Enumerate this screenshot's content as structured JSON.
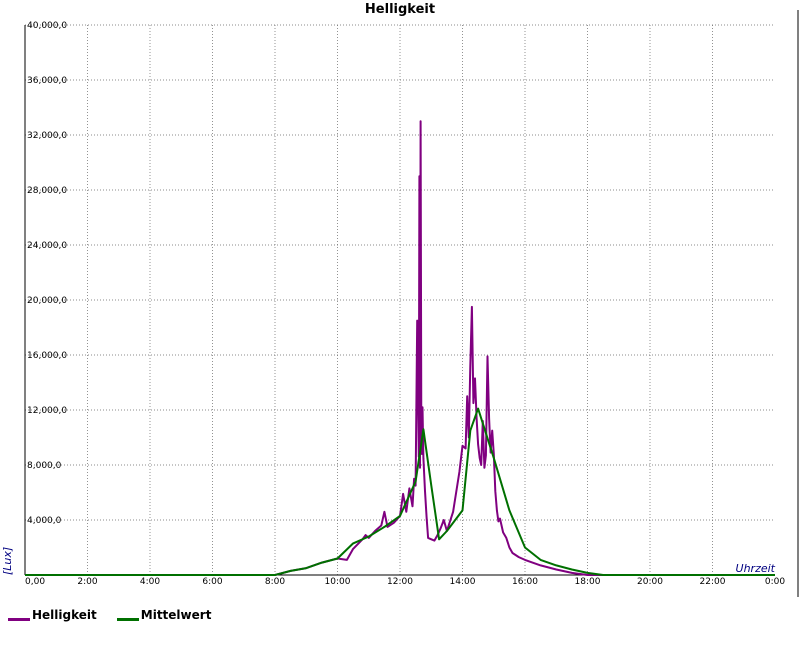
{
  "chart_data": {
    "type": "line",
    "title": "Helligkeit",
    "ylabel": "[Lux]",
    "xlabel": "Uhrzeit",
    "xlim": [
      0,
      24
    ],
    "ylim": [
      0,
      40000
    ],
    "grid": true,
    "legend_position": "bottom-left",
    "x_ticks": [
      "0,00",
      "2:00",
      "4:00",
      "6:00",
      "8:00",
      "10:00",
      "12:00",
      "14:00",
      "16:00",
      "18:00",
      "20:00",
      "22:00",
      "0:00"
    ],
    "y_ticks": [
      "4,000,0",
      "8,000,0",
      "12,000,0",
      "16,000,0",
      "20,000,0",
      "24,000,0",
      "28,000,0",
      "32,000,0",
      "36,000,0",
      "40,000,0"
    ],
    "series": [
      {
        "name": "Helligkeit",
        "color": "#800080",
        "x": [
          0,
          8.0,
          8.5,
          9.0,
          9.5,
          10.0,
          10.3,
          10.5,
          10.8,
          10.9,
          11.0,
          11.2,
          11.4,
          11.5,
          11.6,
          11.8,
          12.0,
          12.1,
          12.2,
          12.3,
          12.4,
          12.45,
          12.5,
          12.55,
          12.6,
          12.62,
          12.64,
          12.66,
          12.68,
          12.7,
          12.72,
          12.75,
          12.8,
          12.85,
          12.9,
          13.0,
          13.1,
          13.2,
          13.3,
          13.4,
          13.5,
          13.7,
          13.9,
          14.0,
          14.1,
          14.15,
          14.2,
          14.25,
          14.3,
          14.35,
          14.4,
          14.45,
          14.5,
          14.55,
          14.6,
          14.65,
          14.7,
          14.75,
          14.8,
          14.85,
          14.9,
          14.95,
          15.0,
          15.05,
          15.1,
          15.15,
          15.2,
          15.3,
          15.4,
          15.5,
          15.6,
          15.8,
          16.0,
          16.5,
          17.0,
          17.5,
          18.0,
          18.5,
          19.0,
          24.0
        ],
        "values": [
          0,
          0,
          300,
          500,
          900,
          1200,
          1100,
          1900,
          2600,
          2900,
          2700,
          3200,
          3600,
          4600,
          3500,
          3800,
          4300,
          5900,
          4600,
          6300,
          5000,
          7000,
          6500,
          18500,
          8600,
          29000,
          7800,
          33000,
          11000,
          8800,
          12200,
          8500,
          6100,
          4200,
          2700,
          2600,
          2500,
          2900,
          3400,
          4000,
          3200,
          4600,
          7500,
          9400,
          9200,
          13000,
          10000,
          15200,
          19500,
          12500,
          14300,
          11400,
          9500,
          8500,
          8000,
          11200,
          7800,
          8700,
          15900,
          11400,
          8900,
          10500,
          8800,
          6100,
          4700,
          3900,
          4100,
          3100,
          2700,
          2000,
          1600,
          1300,
          1100,
          700,
          400,
          150,
          0,
          0,
          0,
          0
        ]
      },
      {
        "name": "Mittelwert",
        "color": "#007000",
        "x": [
          0,
          8.0,
          8.5,
          9.0,
          9.5,
          10.0,
          10.5,
          11.0,
          11.5,
          12.0,
          12.5,
          12.75,
          13.0,
          13.25,
          13.5,
          14.0,
          14.25,
          14.5,
          15.0,
          15.5,
          16.0,
          16.5,
          17.0,
          17.5,
          18.0,
          18.5,
          24.0
        ],
        "values": [
          0,
          0,
          300,
          500,
          900,
          1200,
          2300,
          2800,
          3500,
          4300,
          6800,
          10600,
          6500,
          2600,
          3200,
          4700,
          10500,
          12100,
          8500,
          4700,
          2000,
          1100,
          700,
          400,
          150,
          0,
          0
        ]
      }
    ]
  }
}
